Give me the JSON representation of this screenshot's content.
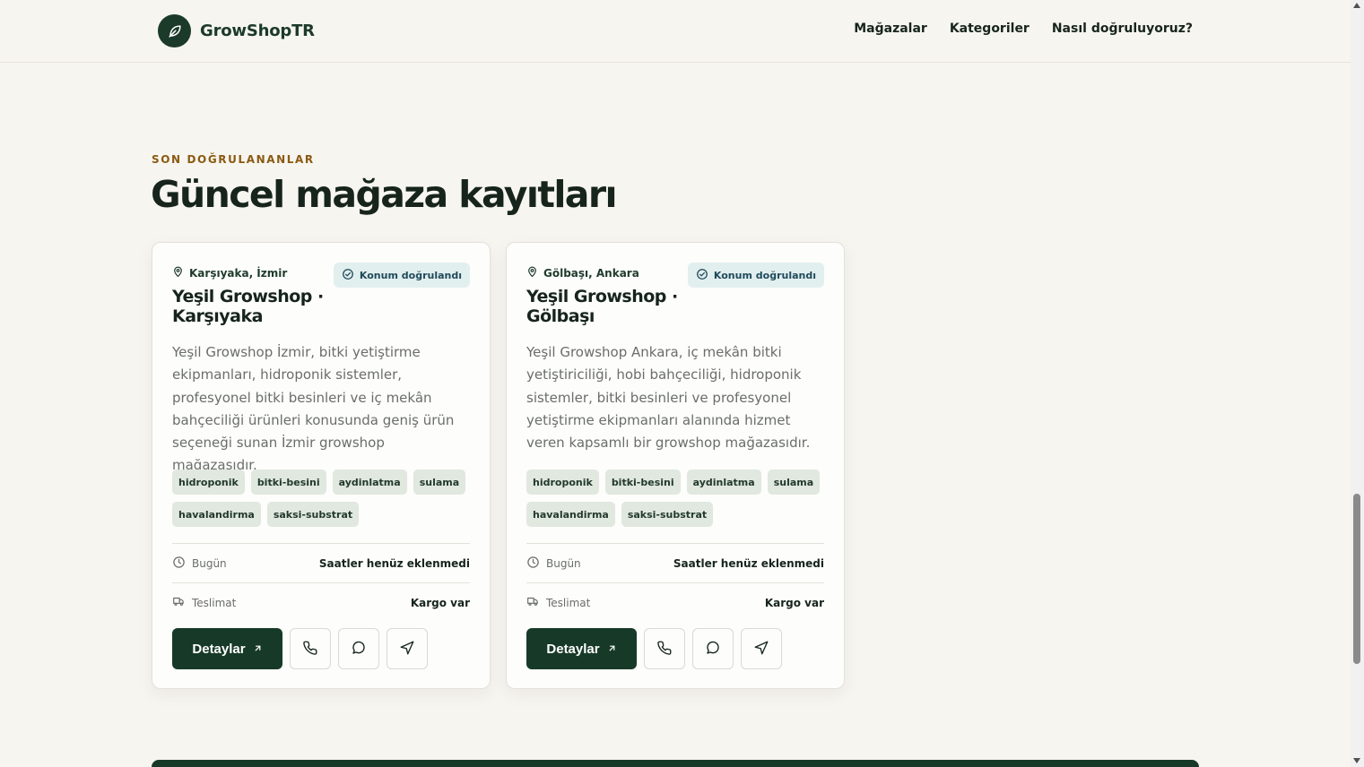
{
  "header": {
    "brand": "GrowShopTR",
    "nav": [
      "Mağazalar",
      "Kategoriler",
      "Nasıl doğruluyoruz?"
    ]
  },
  "section": {
    "eyebrow": "SON DOĞRULANANLAR",
    "title": "Güncel mağaza kayıtları"
  },
  "cards": [
    {
      "location": "Karşıyaka, İzmir",
      "verified": "Konum doğrulandı",
      "title_line1": "Yeşil Growshop ·",
      "title_line2": "Karşıyaka",
      "description": "Yeşil Growshop İzmir, bitki yetiştirme ekipmanları, hidroponik sistemler, profesyonel bitki besinleri ve iç mekân bahçeciliği ürünleri konusunda geniş ürün seçeneği sunan İzmir growshop mağazasıdır.",
      "tags": [
        "hidroponik",
        "bitki-besini",
        "aydinlatma",
        "sulama",
        "havalandirma",
        "saksi-substrat"
      ],
      "hours_label": "Bugün",
      "hours_value": "Saatler henüz eklenmedi",
      "delivery_label": "Teslimat",
      "delivery_value": "Kargo var",
      "details_label": "Detaylar"
    },
    {
      "location": "Gölbaşı, Ankara",
      "verified": "Konum doğrulandı",
      "title_line1": "Yeşil Growshop ·",
      "title_line2": "Gölbaşı",
      "description": "Yeşil Growshop Ankara, iç mekân bitki yetiştiriciliği, hobi bahçeciliği, hidroponik sistemler, bitki besinleri ve profesyonel yetiştirme ekipmanları alanında hizmet veren kapsamlı bir growshop mağazasıdır.",
      "tags": [
        "hidroponik",
        "bitki-besini",
        "aydinlatma",
        "sulama",
        "havalandirma",
        "saksi-substrat"
      ],
      "hours_label": "Bugün",
      "hours_value": "Saatler henüz eklenmedi",
      "delivery_label": "Teslimat",
      "delivery_value": "Kargo var",
      "details_label": "Detaylar"
    }
  ],
  "colors": {
    "brand_dark": "#173a28",
    "eyebrow": "#8a5a12",
    "verified_bg": "#e2efef",
    "tag_bg": "#e0e8df",
    "page_bg": "#f7f5f0"
  },
  "icons": [
    "leaf-icon",
    "map-pin-icon",
    "check-circle-icon",
    "clock-icon",
    "truck-icon",
    "arrow-up-right-icon",
    "phone-icon",
    "message-icon",
    "navigation-icon"
  ]
}
